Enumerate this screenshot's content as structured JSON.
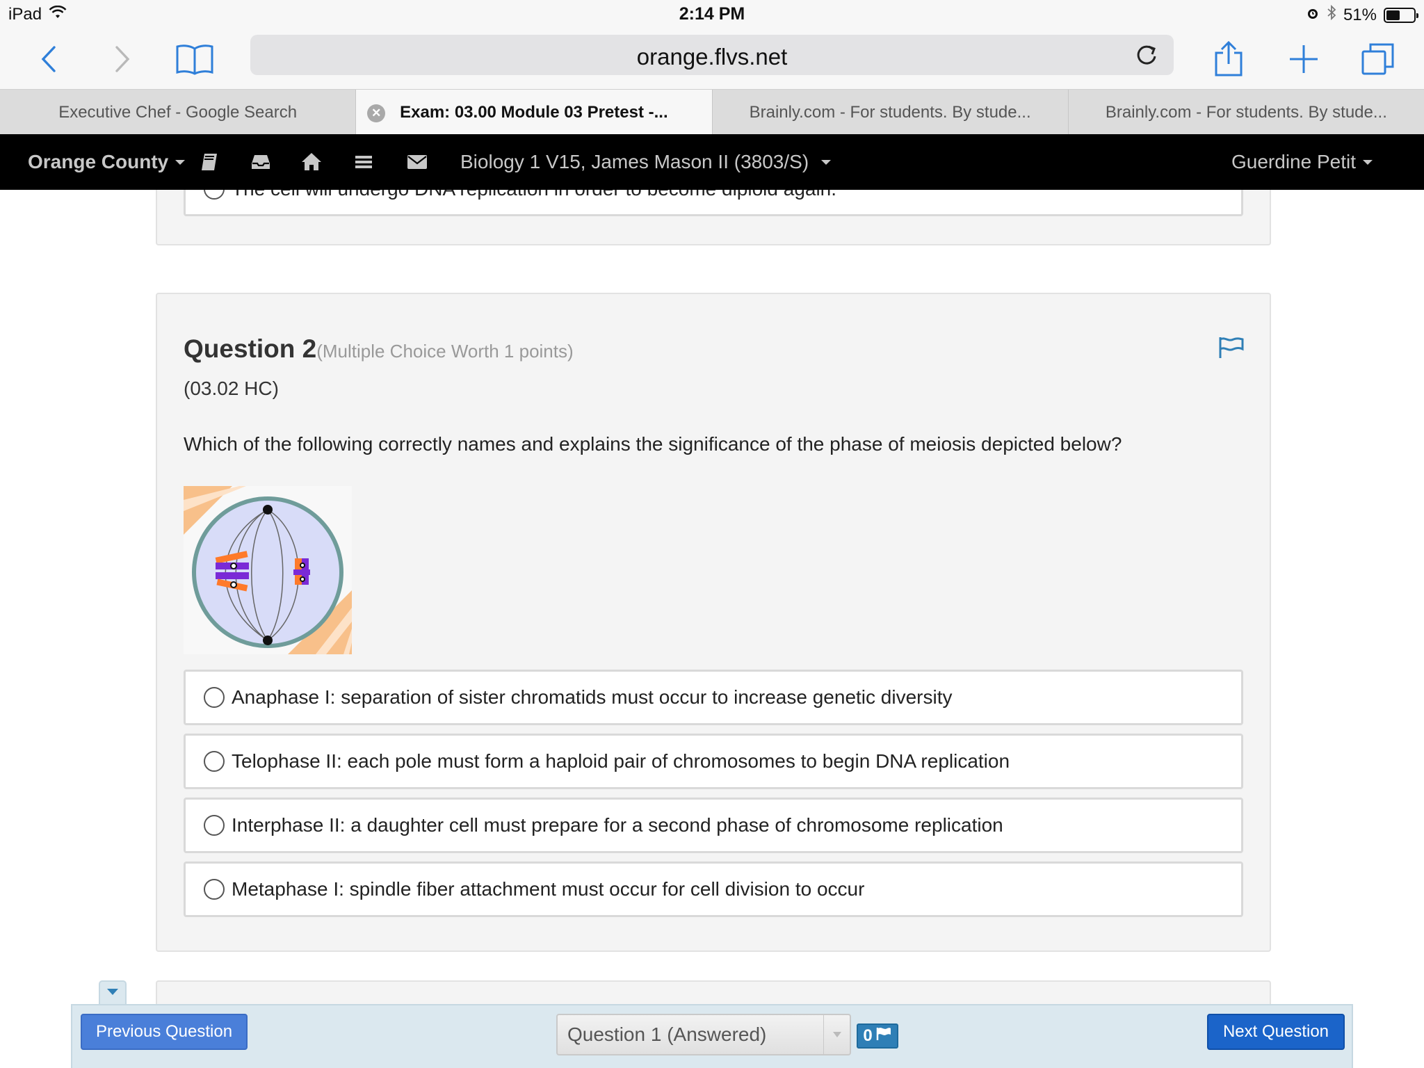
{
  "status_bar": {
    "device": "iPad",
    "time": "2:14 PM",
    "battery": "51%",
    "battery_level": 0.51
  },
  "browser": {
    "url": "orange.flvs.net",
    "tabs": [
      {
        "label": "Executive Chef - Google Search",
        "active": false
      },
      {
        "label": "Exam: 03.00 Module 03 Pretest -...",
        "active": true
      },
      {
        "label": "Brainly.com - For students. By stude...",
        "active": false
      },
      {
        "label": "Brainly.com - For students. By stude...",
        "active": false
      }
    ]
  },
  "site_nav": {
    "school": "Orange County",
    "course": "Biology 1 V15, James Mason II (3803/S)",
    "user": "Guerdine Petit"
  },
  "prev_question": {
    "last_option": "The cell will undergo DNA replication in order to become diploid again."
  },
  "question": {
    "title": "Question 2",
    "meta": "(Multiple Choice Worth 1 points)",
    "code": "(03.02 HC)",
    "text": "Which of the following correctly names and explains the significance of the phase of meiosis depicted below?",
    "options": [
      "Anaphase I: separation of sister chromatids must occur to increase genetic diversity",
      "Telophase II: each pole must form a haploid pair of chromosomes to begin DNA replication",
      "Interphase II: a daughter cell must prepare for a second phase of chromosome replication",
      "Metaphase I: spindle fiber attachment must occur for cell division to occur"
    ]
  },
  "footer": {
    "prev_label": "Previous Question",
    "next_label": "Next Question",
    "question_select": "Question 1 (Answered)",
    "flag_count": "0"
  },
  "colors": {
    "nav_bg": "#000000",
    "ios_blue": "#2f7fd9",
    "next_button": "#1b64c9",
    "prev_button": "#4a7fd9",
    "flag_blue": "#2f7fb6"
  }
}
